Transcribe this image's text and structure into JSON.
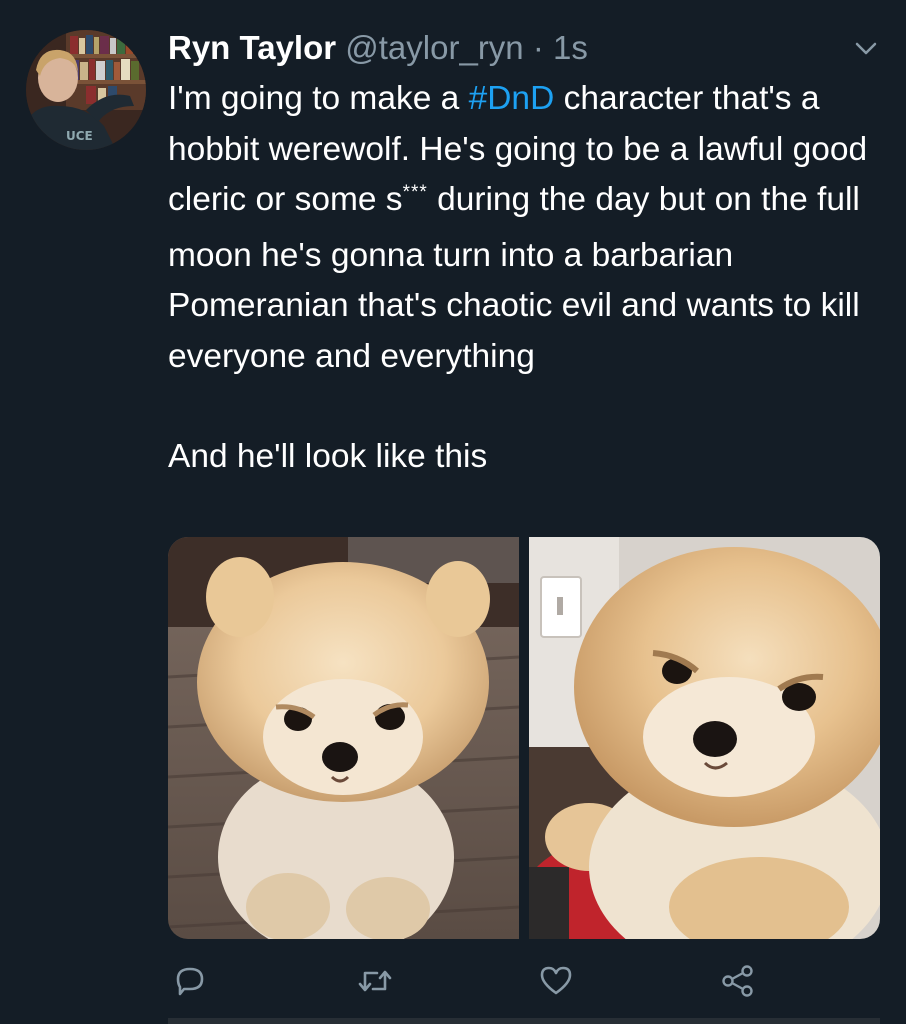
{
  "tweet": {
    "author": {
      "display_name": "Ryn Taylor",
      "handle": "@taylor_ryn",
      "separator": "·",
      "timestamp": "1s"
    },
    "text": {
      "line_prefix": "I'm going to make a",
      "hashtag": "#DnD",
      "after_hashtag": "character that's a hobbit werewolf. He's going to be a lawful good cleric or some s",
      "censored": "***",
      "after_censored": "during the day but on the full moon he's gonna turn into a barbarian Pomeranian that's chaotic evil and wants to kill everyone and everything",
      "paragraph_2": "And he'll look like this"
    },
    "media": [
      {
        "description_icon": "pomeranian-photo",
        "label": "photo 1"
      },
      {
        "description_icon": "pomeranian-photo",
        "label": "photo 2"
      }
    ]
  },
  "actions": {
    "reply_icon": "reply-icon",
    "retweet_icon": "retweet-icon",
    "like_icon": "heart-icon",
    "share_icon": "share-icon"
  },
  "colors": {
    "background": "#141d26",
    "text": "#ffffff",
    "secondary": "#8899a6",
    "link": "#1da1f2"
  }
}
